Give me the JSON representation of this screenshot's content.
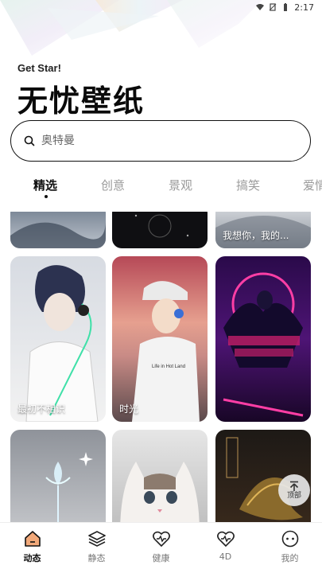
{
  "status_bar": {
    "time": "2:17"
  },
  "header": {
    "subtitle": "Get Star!",
    "title": "无忧壁纸"
  },
  "search": {
    "placeholder": "奥特曼"
  },
  "tabs": [
    {
      "label": "精选",
      "active": true
    },
    {
      "label": "创意"
    },
    {
      "label": "景观"
    },
    {
      "label": "搞笑"
    },
    {
      "label": "爱情"
    }
  ],
  "cards": [
    {
      "label": ""
    },
    {
      "label": ""
    },
    {
      "label": "我想你，我的..."
    },
    {
      "label": "最初不相识"
    },
    {
      "label": "时光"
    },
    {
      "label": ""
    },
    {
      "label": ""
    },
    {
      "label": ""
    },
    {
      "label": ""
    }
  ],
  "to_top": {
    "label": "顶部"
  },
  "bottom_nav": [
    {
      "label": "动态",
      "icon": "home-icon",
      "active": true
    },
    {
      "label": "静态",
      "icon": "layers-icon"
    },
    {
      "label": "健康",
      "icon": "heart-pulse-icon"
    },
    {
      "label": "4D",
      "icon": "heart-pulse-icon"
    },
    {
      "label": "我的",
      "icon": "face-icon"
    }
  ]
}
